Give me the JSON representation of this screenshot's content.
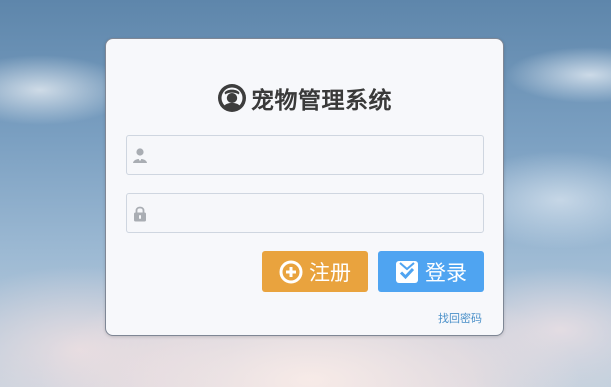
{
  "app": {
    "title": "宠物管理系统",
    "logo_icon": "pet-face-icon"
  },
  "form": {
    "username": {
      "value": "",
      "placeholder": "",
      "icon": "user-icon"
    },
    "password": {
      "value": "",
      "placeholder": "",
      "icon": "lock-icon"
    }
  },
  "actions": {
    "register_label": "注册",
    "register_icon": "plus-circle-icon",
    "login_label": "登录",
    "login_icon": "check-square-icon",
    "forgot_label": "找回密码"
  },
  "colors": {
    "register": "#e9a33e",
    "login": "#4fa4f1",
    "link": "#4a90c9",
    "title": "#3a3a3a"
  }
}
